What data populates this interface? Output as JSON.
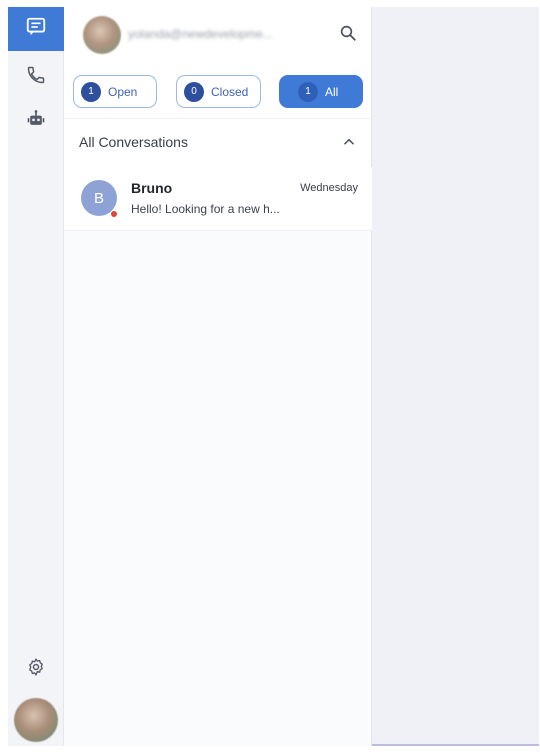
{
  "rail": {
    "items": [
      {
        "name": "conversations",
        "icon": "chat-icon",
        "active": true
      },
      {
        "name": "calls",
        "icon": "phone-icon",
        "active": false
      },
      {
        "name": "bots",
        "icon": "robot-icon",
        "active": false
      }
    ],
    "settings_icon": "gear-icon"
  },
  "header": {
    "email": "yolanda@newdevelopme...",
    "search_icon": "search-icon"
  },
  "filters": [
    {
      "label": "Open",
      "count": "1"
    },
    {
      "label": "Closed",
      "count": "0"
    },
    {
      "label": "All",
      "count": "1"
    }
  ],
  "section": {
    "title": "All Conversations",
    "toggle_icon": "chevron-up-icon"
  },
  "conversations": [
    {
      "initial": "B",
      "name": "Bruno",
      "time": "Wednesday",
      "preview": "Hello! Looking for a new h...",
      "status_color": "#e0443b"
    }
  ],
  "colors": {
    "accent": "#3f7ad6",
    "count_badge": "#2d4f9e",
    "avatar_bg": "#8ea2d6"
  }
}
